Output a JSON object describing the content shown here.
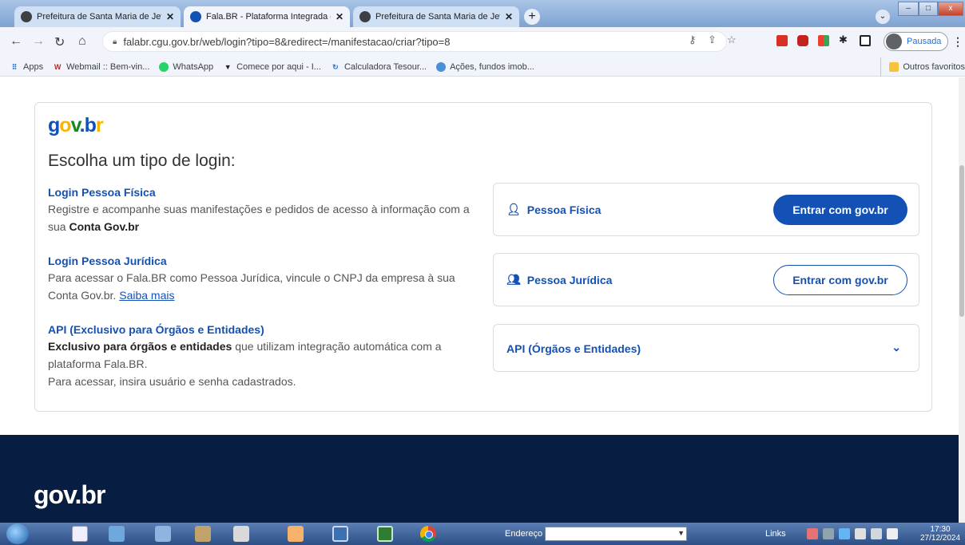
{
  "browser": {
    "tabs": [
      {
        "title": "Prefeitura de Santa Maria de Jeti",
        "close": "✕",
        "active": false
      },
      {
        "title": "Fala.BR - Plataforma Integrada de",
        "close": "✕",
        "active": true
      },
      {
        "title": "Prefeitura de Santa Maria de Jeti",
        "close": "✕",
        "active": false
      }
    ],
    "new_tab": "+",
    "url": "falabr.cgu.gov.br/web/login?tipo=8&redirect=/manifestacao/criar?tipo=8",
    "profile_label": "Pausada",
    "bookmarks": [
      {
        "label": "Apps",
        "icon": "apps-grid-icon"
      },
      {
        "label": "Webmail :: Bem-vin...",
        "icon": "webmail-icon"
      },
      {
        "label": "WhatsApp",
        "icon": "whatsapp-icon"
      },
      {
        "label": "Comece por aqui - I...",
        "icon": "bookmark-icon"
      },
      {
        "label": "Calculadora Tesour...",
        "icon": "calculator-icon"
      },
      {
        "label": "Ações, fundos imob...",
        "icon": "stocks-icon"
      }
    ],
    "other_bookmarks": "Outros favoritos"
  },
  "page": {
    "logo": "gov.br",
    "heading": "Escolha um tipo de login:",
    "options": [
      {
        "title": "Login Pessoa Física",
        "description": "Registre e acompanhe suas manifestações e pedidos de acesso à informação com a sua ",
        "description_bold": "Conta Gov.br",
        "box_label": "Pessoa Física",
        "button": "Entrar com gov.br"
      },
      {
        "title": "Login Pessoa Jurídica",
        "description": "Para acessar o Fala.BR como Pessoa Jurídica, vincule o CNPJ da empresa à sua Conta Gov.br. ",
        "link": "Saiba mais",
        "box_label": "Pessoa Jurídica",
        "button": "Entrar com gov.br"
      },
      {
        "title": "API (Exclusivo para Órgãos e Entidades)",
        "description_bold": "Exclusivo para órgãos e entidades",
        "description": " que utilizam integração automática com a plataforma Fala.BR.",
        "description_2": "Para acessar, insira usuário e senha cadastrados.",
        "box_label": "API (Órgãos e Entidades)"
      }
    ],
    "footer_logo": "gov.br"
  },
  "taskbar": {
    "address_label": "Endereço",
    "links_label": "Links",
    "time": "17:30",
    "date": "27/12/2024"
  },
  "colors": {
    "primary": "#1351b4",
    "footer": "#071d41",
    "logo_yellow": "#f8b500",
    "logo_green": "#168821"
  }
}
